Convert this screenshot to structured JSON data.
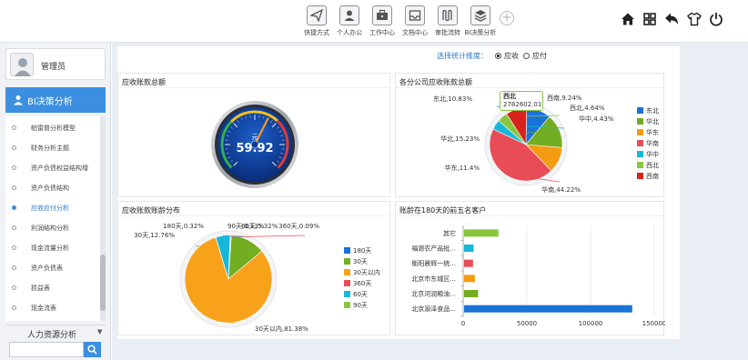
{
  "toolbar": {
    "items": [
      {
        "label": "快捷方式",
        "icon": "send-icon"
      },
      {
        "label": "个人办公",
        "icon": "person-icon"
      },
      {
        "label": "工作中心",
        "icon": "briefcase-icon"
      },
      {
        "label": "文档中心",
        "icon": "inbox-icon"
      },
      {
        "label": "审批流转",
        "icon": "flow-icon"
      },
      {
        "label": "BI决策分析",
        "icon": "layers-icon"
      }
    ],
    "right_icons": [
      "home-icon",
      "grid-icon",
      "back-icon",
      "shirt-icon",
      "power-icon"
    ]
  },
  "sidebar": {
    "user_name": "管理员",
    "module_title": "BI决策分析",
    "menu_items": [
      {
        "label": "帕雷普分析模型",
        "active": false
      },
      {
        "label": "财务分析主题",
        "active": false
      },
      {
        "label": "资产负债权益结构增",
        "active": false
      },
      {
        "label": "资产负债结构",
        "active": false
      },
      {
        "label": "应收应付分析",
        "active": true
      },
      {
        "label": "利润结构分析",
        "active": false
      },
      {
        "label": "现金流量分析",
        "active": false
      },
      {
        "label": "资产负债表",
        "active": false
      },
      {
        "label": "损益表",
        "active": false
      },
      {
        "label": "现金流表",
        "active": false
      }
    ],
    "hr_section": "人力资源分析",
    "search_placeholder": ""
  },
  "filter": {
    "label": "选择统计维度：",
    "options": [
      {
        "label": "应收",
        "selected": true
      },
      {
        "label": "应付",
        "selected": false
      }
    ]
  },
  "panels": {
    "gauge_title": "应收账款总额",
    "company_title": "各分公司应收账款总额",
    "aging_title": "应收账款账龄分布",
    "top5_title": "账龄在180天的前五名客户"
  },
  "gauge": {
    "unit": "元",
    "value": 59.92,
    "display": "59.92"
  },
  "colors": {
    "accent": "#3c8fe0",
    "east_north": "#1a73d6",
    "north": "#73ad21",
    "east": "#f39c12",
    "south": "#e84c57",
    "central": "#17b7d9",
    "northwest": "#8ac53e",
    "southwest": "#d7231c",
    "aging_180": "#1a73d6",
    "aging_30": "#73ad21",
    "aging_within30": "#f7a21a",
    "aging_360": "#e84c57",
    "aging_60": "#17b7d9",
    "aging_90": "#8ac53e",
    "bar_primary": "#1a73d6"
  },
  "chart_data": [
    {
      "type": "pie",
      "title": "各分公司应收账款总额",
      "series": [
        {
          "name": "",
          "data": [
            {
              "name": "东北",
              "value": 10.83,
              "label": "东北,10.83%",
              "color": "#1a73d6"
            },
            {
              "name": "华北",
              "value": 15.23,
              "label": "华北,15.23%",
              "color": "#73ad21"
            },
            {
              "name": "华东",
              "value": 11.4,
              "label": "华东,11.4%",
              "color": "#f39c12"
            },
            {
              "name": "华南",
              "value": 44.22,
              "label": "华南,44.22%",
              "color": "#e84c57"
            },
            {
              "name": "华中",
              "value": 4.43,
              "label": "华中,4.43%",
              "color": "#17b7d9"
            },
            {
              "name": "西北",
              "value": 4.64,
              "label": "西北,4.64%",
              "color": "#8ac53e"
            },
            {
              "name": "西南",
              "value": 9.24,
              "label": "西南,9.24%",
              "color": "#d7231c"
            }
          ]
        }
      ],
      "legend": [
        "东北",
        "华北",
        "华东",
        "华南",
        "华中",
        "西北",
        "西南"
      ],
      "legend_position": "right",
      "tooltip": {
        "name": "西北",
        "value": "2782602.01"
      }
    },
    {
      "type": "pie",
      "title": "应收账款账龄分布",
      "series": [
        {
          "name": "",
          "data": [
            {
              "name": "180天",
              "value": 0.32,
              "label": "180天,0.32%",
              "color": "#1a73d6"
            },
            {
              "name": "30天",
              "value": 12.76,
              "label": "30天,12.76%",
              "color": "#73ad21"
            },
            {
              "name": "30天以内",
              "value": 81.38,
              "label": "30天以内,81.38%",
              "color": "#f7a21a"
            },
            {
              "name": "360天",
              "value": 0.09,
              "label": "360天,0.09%",
              "color": "#e84c57"
            },
            {
              "name": "60天",
              "value": 5.32,
              "label": "60天,5.32%",
              "color": "#17b7d9"
            },
            {
              "name": "90天",
              "value": 0.13,
              "label": "90天,0.13%",
              "color": "#8ac53e"
            }
          ]
        }
      ],
      "legend": [
        "180天",
        "30天",
        "30天以内",
        "360天",
        "60天",
        "90天"
      ],
      "legend_position": "right"
    },
    {
      "type": "bar",
      "orientation": "horizontal",
      "title": "账龄在180天的前五名客户",
      "categories": [
        "北京源泽食品...",
        "北京河润粮油...",
        "北京市东城区...",
        "衡阳晨辉一统...",
        "福源农产品批...",
        "其它"
      ],
      "values": [
        132000,
        11000,
        8500,
        7000,
        7500,
        27000
      ],
      "colors": [
        "#1a73d6",
        "#73ad21",
        "#f39c12",
        "#e84c57",
        "#17b7d9",
        "#8ac53e"
      ],
      "xticks": [
        "0",
        "50000",
        "100000",
        "150000"
      ],
      "xlim": [
        0,
        150000
      ],
      "grid": true
    }
  ]
}
